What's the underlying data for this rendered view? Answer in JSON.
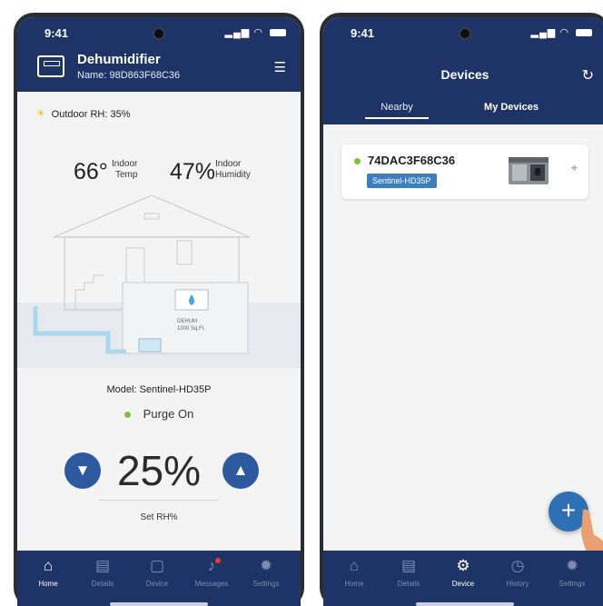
{
  "left_screen": {
    "status": {
      "time": "9:41"
    },
    "header": {
      "title": "Dehumidifier",
      "subtitle": "Name: 98D863F68C36",
      "device_icon": "dehumidifier-icon",
      "menu_icon": "menu-icon"
    },
    "outdoor_rh": "Outdoor RH: 35%",
    "indoor_temp": {
      "value": "66°",
      "label_line1": "Indoor",
      "label_line2": "Temp"
    },
    "indoor_humidity": {
      "value": "47%",
      "label_line1": "Indoor",
      "label_line2": "Humidity"
    },
    "house": {
      "unit_label_line1": "DEHUM",
      "unit_label_line2": "1000 Sq.Ft."
    },
    "model": "Model: Sentinel-HD35P",
    "status_text": "Purge On",
    "set_rh": {
      "value": "25%",
      "label": "Set RH%"
    },
    "tabs": [
      {
        "label": "Home",
        "icon": "home-icon",
        "active": true
      },
      {
        "label": "Details",
        "icon": "details-icon",
        "active": false
      },
      {
        "label": "Device",
        "icon": "device-icon",
        "active": false
      },
      {
        "label": "Messages",
        "icon": "bell-icon",
        "active": false
      },
      {
        "label": "Settings",
        "icon": "gear-icon",
        "active": false
      }
    ]
  },
  "right_screen": {
    "status": {
      "time": "9:41"
    },
    "header": {
      "title": "Devices",
      "refresh_icon": "refresh-icon"
    },
    "segments": {
      "nearby": "Nearby",
      "my_devices": "My Devices"
    },
    "device_card": {
      "id": "74DAC3F68C36",
      "model": "Sentinel-HD35P",
      "status_color": "#7cc142"
    },
    "fab_label": "+",
    "tabs": [
      {
        "label": "Home",
        "icon": "home-icon",
        "active": false
      },
      {
        "label": "Details",
        "icon": "details-icon",
        "active": false
      },
      {
        "label": "Device",
        "icon": "gear-device-icon",
        "active": true
      },
      {
        "label": "History",
        "icon": "history-icon",
        "active": false
      },
      {
        "label": "Settings",
        "icon": "gear-icon",
        "active": false
      }
    ]
  },
  "colors": {
    "header_blue": "#1e3466",
    "accent_blue": "#2d5a9e",
    "status_green": "#7cc142",
    "badge_red": "#e53935"
  }
}
